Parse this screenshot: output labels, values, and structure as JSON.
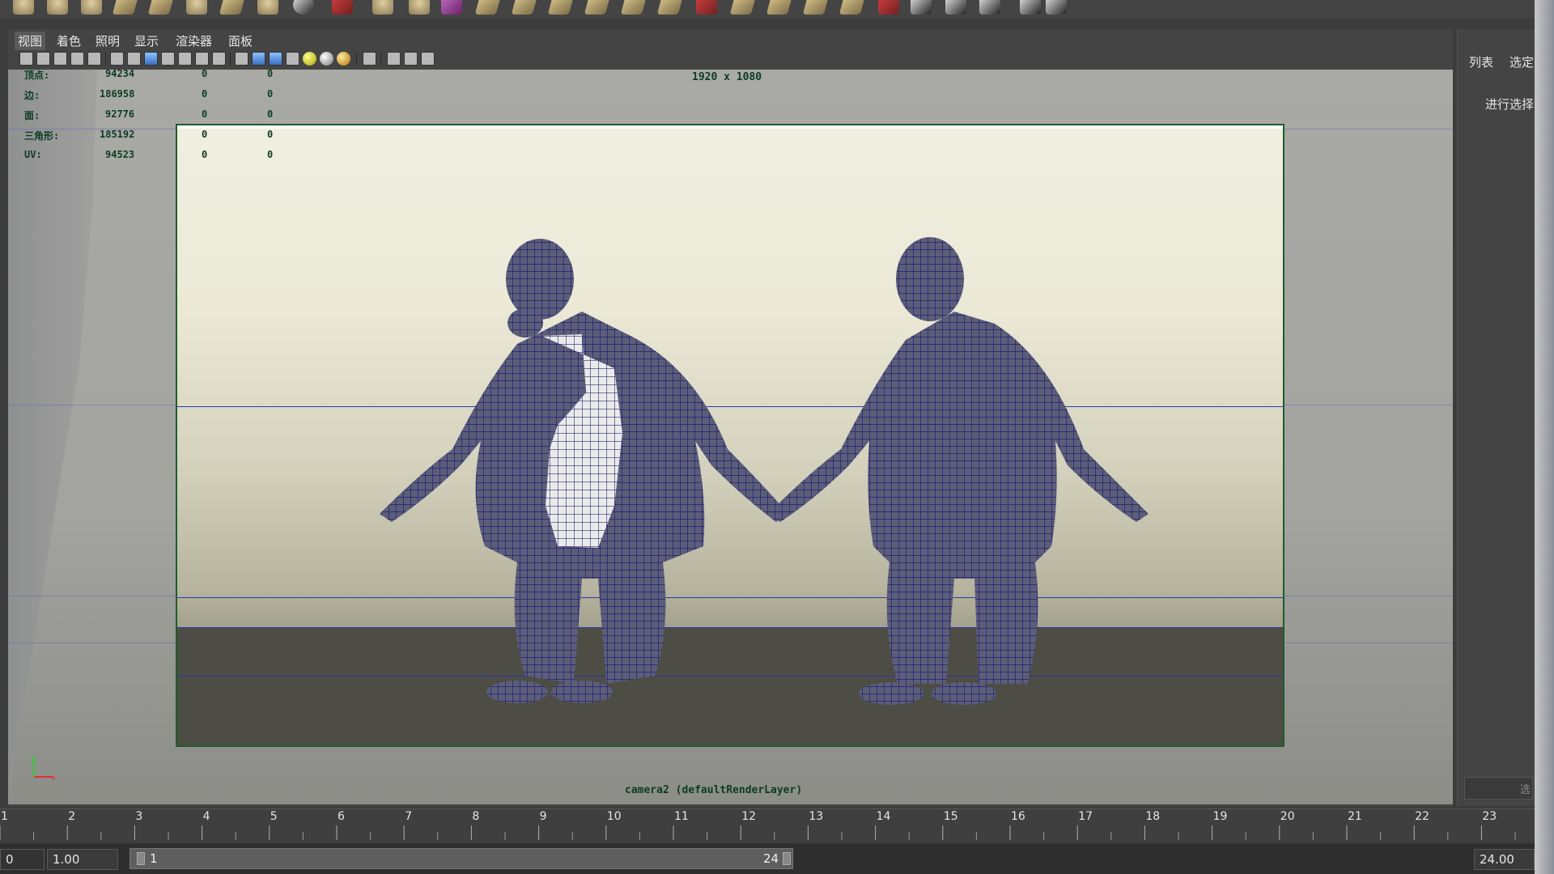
{
  "menu": [
    "视图",
    "着色",
    "照明",
    "显示",
    "渲染器",
    "面板"
  ],
  "stats": [
    {
      "label": "顶点:",
      "value": "94234",
      "c1": "0",
      "c2": "0"
    },
    {
      "label": "边:",
      "value": "186958",
      "c1": "0",
      "c2": "0"
    },
    {
      "label": "面:",
      "value": "92776",
      "c1": "0",
      "c2": "0"
    },
    {
      "label": "三角形:",
      "value": "185192",
      "c1": "0",
      "c2": "0"
    },
    {
      "label": "UV:",
      "value": "94523",
      "c1": "0",
      "c2": "0"
    }
  ],
  "viewport": {
    "resolution": "1920 x 1080",
    "camera": "camera2 (defaultRenderLayer)"
  },
  "right_panel": {
    "tab_list": "列表",
    "tab_selected": "选定",
    "hint": "进行选择",
    "field_text": "选"
  },
  "timeline": {
    "ticks": [
      "1",
      "2",
      "3",
      "4",
      "5",
      "6",
      "7",
      "8",
      "9",
      "10",
      "11",
      "12",
      "13",
      "14",
      "15",
      "16",
      "17",
      "18",
      "19",
      "20",
      "21",
      "22",
      "23"
    ]
  },
  "range": {
    "start_field": "0",
    "start_time": "1.00",
    "slider_start": "1",
    "slider_end": "24",
    "end_time": "24.00"
  },
  "colors": {
    "wireframe": "#2a2a8a",
    "frame_border": "#1f5c2c",
    "hud_text": "#0c3c24"
  }
}
